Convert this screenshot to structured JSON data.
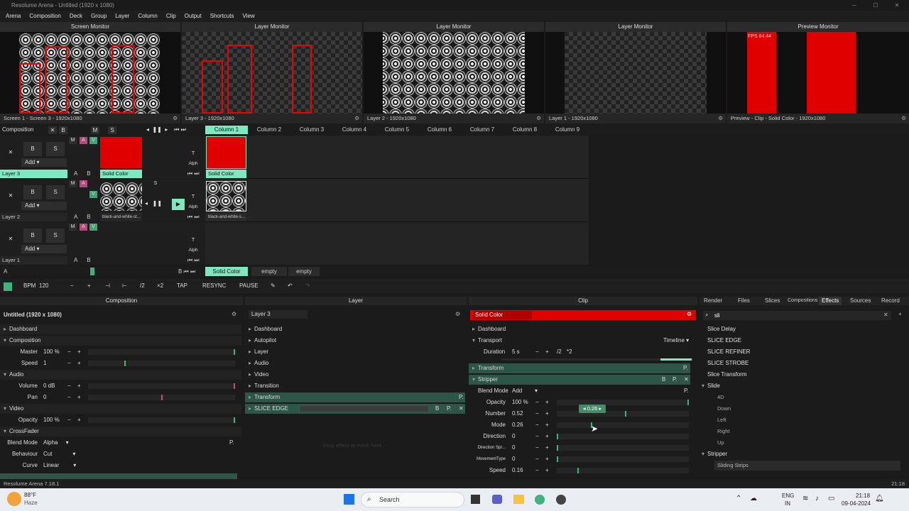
{
  "title": "Resolume Arena - Untitled (1920 x 1080)",
  "menu": [
    "Arena",
    "Composition",
    "Deck",
    "Group",
    "Layer",
    "Column",
    "Clip",
    "Output",
    "Shortcuts",
    "View"
  ],
  "monitors": [
    {
      "title": "Screen Monitor",
      "caption": "Screen 1 - Screen 3 - 1920x1080"
    },
    {
      "title": "Layer Monitor",
      "caption": "Layer 3 - 1920x1080"
    },
    {
      "title": "Layer Monitor",
      "caption": "Layer 2 - 1920x1080"
    },
    {
      "title": "Layer Monitor",
      "caption": "Layer 1 - 1920x1080"
    },
    {
      "title": "Preview Monitor",
      "caption": "Preview - Clip - Solid Color - 1920x1080",
      "fps": "FPS 84.44"
    }
  ],
  "composition_label": "Composition",
  "columns": [
    "Column 1",
    "Column 2",
    "Column 3",
    "Column 4",
    "Column 5",
    "Column 6",
    "Column 7",
    "Column 8",
    "Column 9"
  ],
  "layers": [
    {
      "name": "Layer 3",
      "clip": "Solid Color",
      "grid_clip": "Solid Color"
    },
    {
      "name": "Layer 2",
      "clip": "black-and-white-st...",
      "grid_clip": "black-and-white-s..."
    },
    {
      "name": "Layer 1",
      "clip": "",
      "grid_clip": ""
    }
  ],
  "deck": [
    "Solid Color",
    "empty",
    "empty"
  ],
  "layer_btns": {
    "b": "B",
    "s": "S",
    "add": "Add",
    "m": "M",
    "a": "A",
    "v": "V",
    "t": "T",
    "alph": "Alph",
    "x": "✕"
  },
  "toolbar": {
    "bpm_label": "BPM",
    "bpm": "120",
    "minus": "−",
    "plus": "+",
    "half": "/2",
    "double": "×2",
    "tap": "TAP",
    "resync": "RESYNC",
    "pause": "PAUSE"
  },
  "composition_panel": {
    "header": "Composition",
    "name": "Untitled (1920 x 1080)",
    "rows": [
      {
        "type": "sect",
        "label": "Dashboard"
      },
      {
        "type": "sect",
        "label": "Composition"
      },
      {
        "type": "param",
        "label": "Master",
        "value": "100 %",
        "level": 1.0
      },
      {
        "type": "param",
        "label": "Speed",
        "value": "1",
        "level": 0.25
      },
      {
        "type": "sect",
        "label": "Audio"
      },
      {
        "type": "param",
        "label": "Volume",
        "value": "0 dB",
        "level": 1.0
      },
      {
        "type": "param",
        "label": "Pan",
        "value": "0",
        "level": 0.5
      },
      {
        "type": "sect",
        "label": "Video"
      },
      {
        "type": "param",
        "label": "Opacity",
        "value": "100 %",
        "level": 1.0
      },
      {
        "type": "sect",
        "label": "CrossFader"
      },
      {
        "type": "drop",
        "label": "Blend Mode",
        "value": "Alpha"
      },
      {
        "type": "drop",
        "label": "Behaviour",
        "value": "Cut"
      },
      {
        "type": "drop",
        "label": "Curve",
        "value": "Linear"
      }
    ]
  },
  "layer_panel": {
    "header": "Layer",
    "name": "Layer 3",
    "rows": [
      "Dashboard",
      "Autopilot",
      "Layer",
      "Audio",
      "Video",
      "Transition",
      "Transform",
      "SLICE EDGE"
    ],
    "drop_hint": "Drop effect or mask here."
  },
  "clip_panel": {
    "header": "Clip",
    "name": "Solid Color",
    "dashboard": "Dashboard",
    "transport": "Transport",
    "timeline": "Timeline",
    "duration_label": "Duration",
    "duration": "5 s",
    "transform": "Transform",
    "stripper": "Stripper",
    "blend_label": "Blend Mode",
    "blend": "Add",
    "params": [
      {
        "label": "Opacity",
        "value": "100 %",
        "level": 1.0
      },
      {
        "label": "Number",
        "value": "0.52",
        "level": 0.52
      },
      {
        "label": "Mode",
        "value": "0.26",
        "level": 0.26
      },
      {
        "label": "Direction",
        "value": "0",
        "level": 0.0
      },
      {
        "label": "Direction Spr...",
        "value": "0",
        "level": 0.0
      },
      {
        "label": "MovementType",
        "value": "0",
        "level": 0.0
      },
      {
        "label": "Speed",
        "value": "0.16",
        "level": 0.16
      }
    ],
    "tooltip": "0.26"
  },
  "right_tabs": [
    "Render",
    "Files",
    "Slices",
    "Compositions",
    "Effects",
    "Sources",
    "Record"
  ],
  "search": "sli",
  "effects": [
    "Slice Delay",
    "SLICE EDGE",
    "SLICE REFINER",
    "SLICE STROBE",
    "Slice Transform"
  ],
  "slide_group": "Slide",
  "slide_items": [
    "4D",
    "Down",
    "Left",
    "Right",
    "Up"
  ],
  "stripper_group": "Stripper",
  "stripper_items": [
    "Sliding Strips"
  ],
  "status": {
    "version": "Resolume Arena 7.18.1",
    "time": "21:18"
  },
  "taskbar": {
    "temp": "88°F",
    "weather": "Haze",
    "search": "Search",
    "lang1": "ENG",
    "lang2": "IN",
    "clock": "21:18",
    "date": "09-04-2024"
  }
}
